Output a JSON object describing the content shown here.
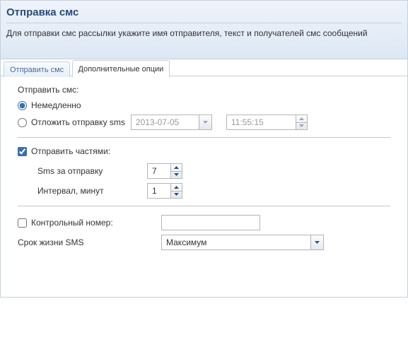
{
  "header": {
    "title": "Отправка смс",
    "description": "Для отправки смс рассылки укажите имя отправителя, текст и получателей смс сообщений"
  },
  "tabs": {
    "send": "Отправить смс",
    "options": "Дополнительные опции"
  },
  "schedule": {
    "group_label": "Отправить смс:",
    "immediate_label": "Немедленно",
    "delay_label": "Отложить отправку sms",
    "date": "2013-07-05",
    "time": "11:55:15"
  },
  "parts": {
    "checkbox_label": "Отправить частями:",
    "per_send_label": "Sms за отправку",
    "per_send_value": "7",
    "interval_label": "Интервал, минут",
    "interval_value": "1"
  },
  "control": {
    "checkbox_label": "Контрольный номер:",
    "value": ""
  },
  "ttl": {
    "label": "Срок жизни SMS",
    "value": "Максимум"
  },
  "colors": {
    "arrow": "#2b4f7d",
    "arrow_disabled": "#9aa6b5"
  }
}
